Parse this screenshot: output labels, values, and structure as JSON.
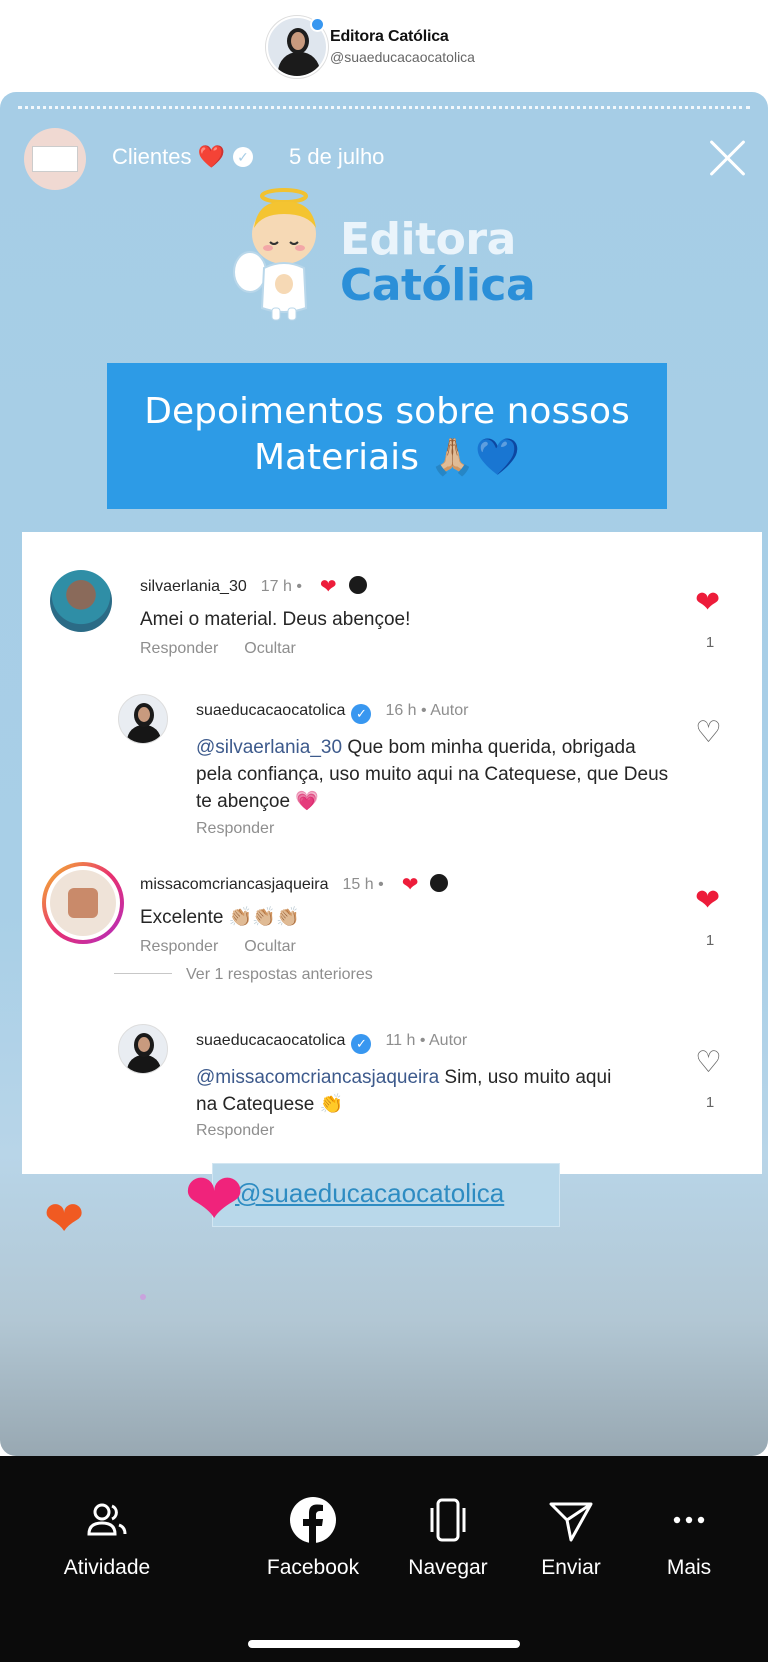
{
  "header": {
    "name": "Editora Católica",
    "handle": "@suaeducacaocatolica"
  },
  "story": {
    "highlight_title": "Clientes ❤️",
    "date": "5 de julho",
    "logo_line1": "Editora",
    "logo_line2": "Católica",
    "banner_line1": "Depoimentos sobre nossos",
    "banner_line2": "Materiais 🙏🏼💙",
    "sticker_text": "@suaeducacaocatolica"
  },
  "comments": [
    {
      "username": "silvaerlania_30",
      "time": "17 h",
      "text": "Amei o material. Deus abençoe!",
      "reply_label": "Responder",
      "hide_label": "Ocultar",
      "likes": "1"
    },
    {
      "username": "suaeducacaocatolica",
      "time": "16 h",
      "author_label": "• Autor",
      "mention": "@silvaerlania_30",
      "text": " Que bom minha querida, obrigada pela confiança, uso muito aqui na Catequese, que Deus te abençoe 💗",
      "reply_label": "Responder"
    },
    {
      "username": "missacomcriancasjaqueira",
      "time": "15 h",
      "text": "Excelente 👏🏼👏🏼👏🏼",
      "reply_label": "Responder",
      "hide_label": "Ocultar",
      "likes": "1"
    },
    {
      "username": "suaeducacaocatolica",
      "time": "11 h",
      "author_label": "• Autor",
      "mention": "@missacomcriancasjaqueira",
      "text": " Sim, uso muito aqui na Catequese 👏",
      "reply_label": "Responder",
      "likes": "1"
    }
  ],
  "view_previous_replies": "Ver 1 respostas anteriores",
  "toolbar": {
    "items": [
      {
        "label": "Atividade",
        "icon": "people-icon"
      },
      {
        "label": "Facebook",
        "icon": "facebook-icon"
      },
      {
        "label": "Navegar",
        "icon": "phone-browse-icon"
      },
      {
        "label": "Enviar",
        "icon": "send-icon"
      },
      {
        "label": "Mais",
        "icon": "more-icon"
      }
    ]
  },
  "colors": {
    "story_bg": "#a6cde6",
    "banner": "#2d9be6",
    "like_red": "#ed1c3a",
    "verified_blue": "#3897f0"
  }
}
